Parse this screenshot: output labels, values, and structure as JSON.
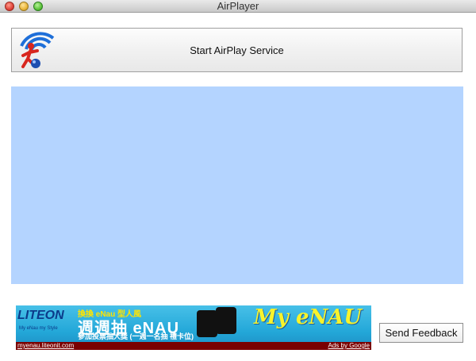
{
  "window": {
    "title": "AirPlayer",
    "controls": [
      "close-button",
      "minimize-button",
      "zoom-button"
    ]
  },
  "service_button": {
    "label": "Start AirPlay Service",
    "icon": "airplay-logo-icon"
  },
  "content_area": {
    "color": "#b4d4ff"
  },
  "ad": {
    "brand": "LITEON",
    "brand_tagline": "My eNau my Style",
    "headline_1": "換換 eNau 型人風",
    "headline_2": "週週抽 eNAU",
    "headline_3": "參加投票抽大獎 (一週一名抽 禮卡位)",
    "script_text": "My eNAU",
    "url": "myenau.liteonit.com",
    "ads_by": "Ads by Google"
  },
  "feedback_button": {
    "label": "Send Feedback"
  },
  "colors": {
    "accent": "#b4d4ff",
    "ad_footer": "#7a0000",
    "ad_background": "#23a7d8"
  }
}
